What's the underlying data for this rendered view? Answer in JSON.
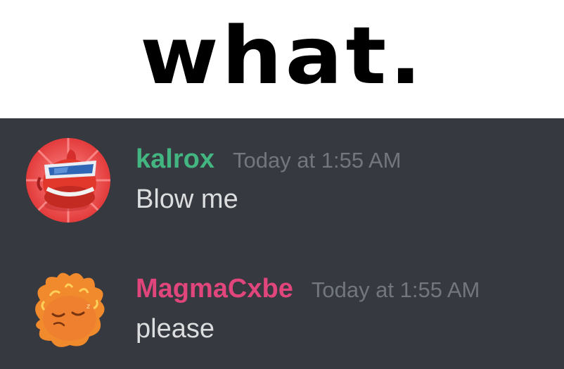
{
  "caption": {
    "text": "what."
  },
  "messages": [
    {
      "username": "kalrox",
      "username_color": "#43b581",
      "timestamp": "Today at 1:55 AM",
      "content": "Blow me",
      "avatar_icon": "red-robot-avatar-icon"
    },
    {
      "username": "MagmaCxbe",
      "username_color": "#e0457b",
      "timestamp": "Today at 1:55 AM",
      "content": "please",
      "avatar_icon": "fire-creature-avatar-icon"
    }
  ],
  "colors": {
    "chat_background": "#36393f",
    "timestamp": "#72767d",
    "message_text": "#dcddde"
  }
}
